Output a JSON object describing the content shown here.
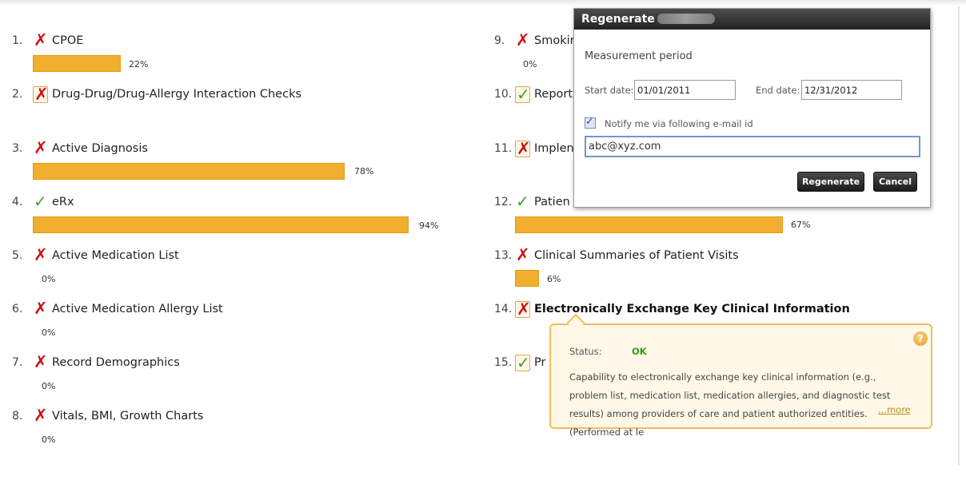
{
  "measures": [
    {
      "num": "1.",
      "status": "fail",
      "label": "CPOE",
      "pct": "22%",
      "value": 0.22
    },
    {
      "num": "2.",
      "status": "fail",
      "label": "Drug-Drug/Drug-Allergy Interaction Checks",
      "pct": "",
      "value": null
    },
    {
      "num": "3.",
      "status": "fail",
      "label": "Active Diagnosis",
      "pct": "78%",
      "value": 0.78
    },
    {
      "num": "4.",
      "status": "ok",
      "label": "eRx",
      "pct": "94%",
      "value": 0.94
    },
    {
      "num": "5.",
      "status": "fail",
      "label": "Active Medication List",
      "pct": "0%",
      "value": 0
    },
    {
      "num": "6.",
      "status": "fail",
      "label": "Active Medication Allergy List",
      "pct": "0%",
      "value": 0
    },
    {
      "num": "7.",
      "status": "fail",
      "label": "Record Demographics",
      "pct": "0%",
      "value": 0
    },
    {
      "num": "8.",
      "status": "fail",
      "label": "Vitals, BMI, Growth Charts",
      "pct": "0%",
      "value": 0
    },
    {
      "num": "9.",
      "status": "fail",
      "label": "Smokin",
      "pct": "0%",
      "value": 0
    },
    {
      "num": "10.",
      "status": "ok",
      "label": "Report",
      "pct": "",
      "value": null
    },
    {
      "num": "11.",
      "status": "fail",
      "label": "Implen",
      "pct": "",
      "value": null
    },
    {
      "num": "12.",
      "status": "ok",
      "label": "Patien",
      "pct": "67%",
      "value": 0.67
    },
    {
      "num": "13.",
      "status": "fail",
      "label": "Clinical Summaries of Patient Visits",
      "pct": "6%",
      "value": 0.06
    },
    {
      "num": "14.",
      "status": "fail",
      "label": "Electronically Exchange Key Clinical Information",
      "pct": "",
      "value": null
    },
    {
      "num": "15.",
      "status": "ok",
      "label": "Pr",
      "pct": "",
      "value": null
    }
  ],
  "dialog": {
    "title": "Regenerate",
    "subtitle": "Measurement period",
    "start_label": "Start date:",
    "start_value": "01/01/2011",
    "end_label": "End date:",
    "end_value": "12/31/2012",
    "notify_label": "Notify me via following e-mail id",
    "email_value": "abc@xyz.com",
    "regenerate_label": "Regenerate",
    "cancel_label": "Cancel"
  },
  "tooltip": {
    "status_label": "Status:",
    "status_value": "OK",
    "description": "Capability to electronically exchange key clinical information (e.g., problem list, medication list, medication allergies, and diagnostic test results) among providers of care and patient authorized entities. (Performed at le",
    "more_label": "...more",
    "help_glyph": "?"
  },
  "colors": {
    "bar": "#f2ae2e",
    "fail": "#cc1010",
    "ok": "#3aa12c",
    "dialog_title": "#333333"
  }
}
